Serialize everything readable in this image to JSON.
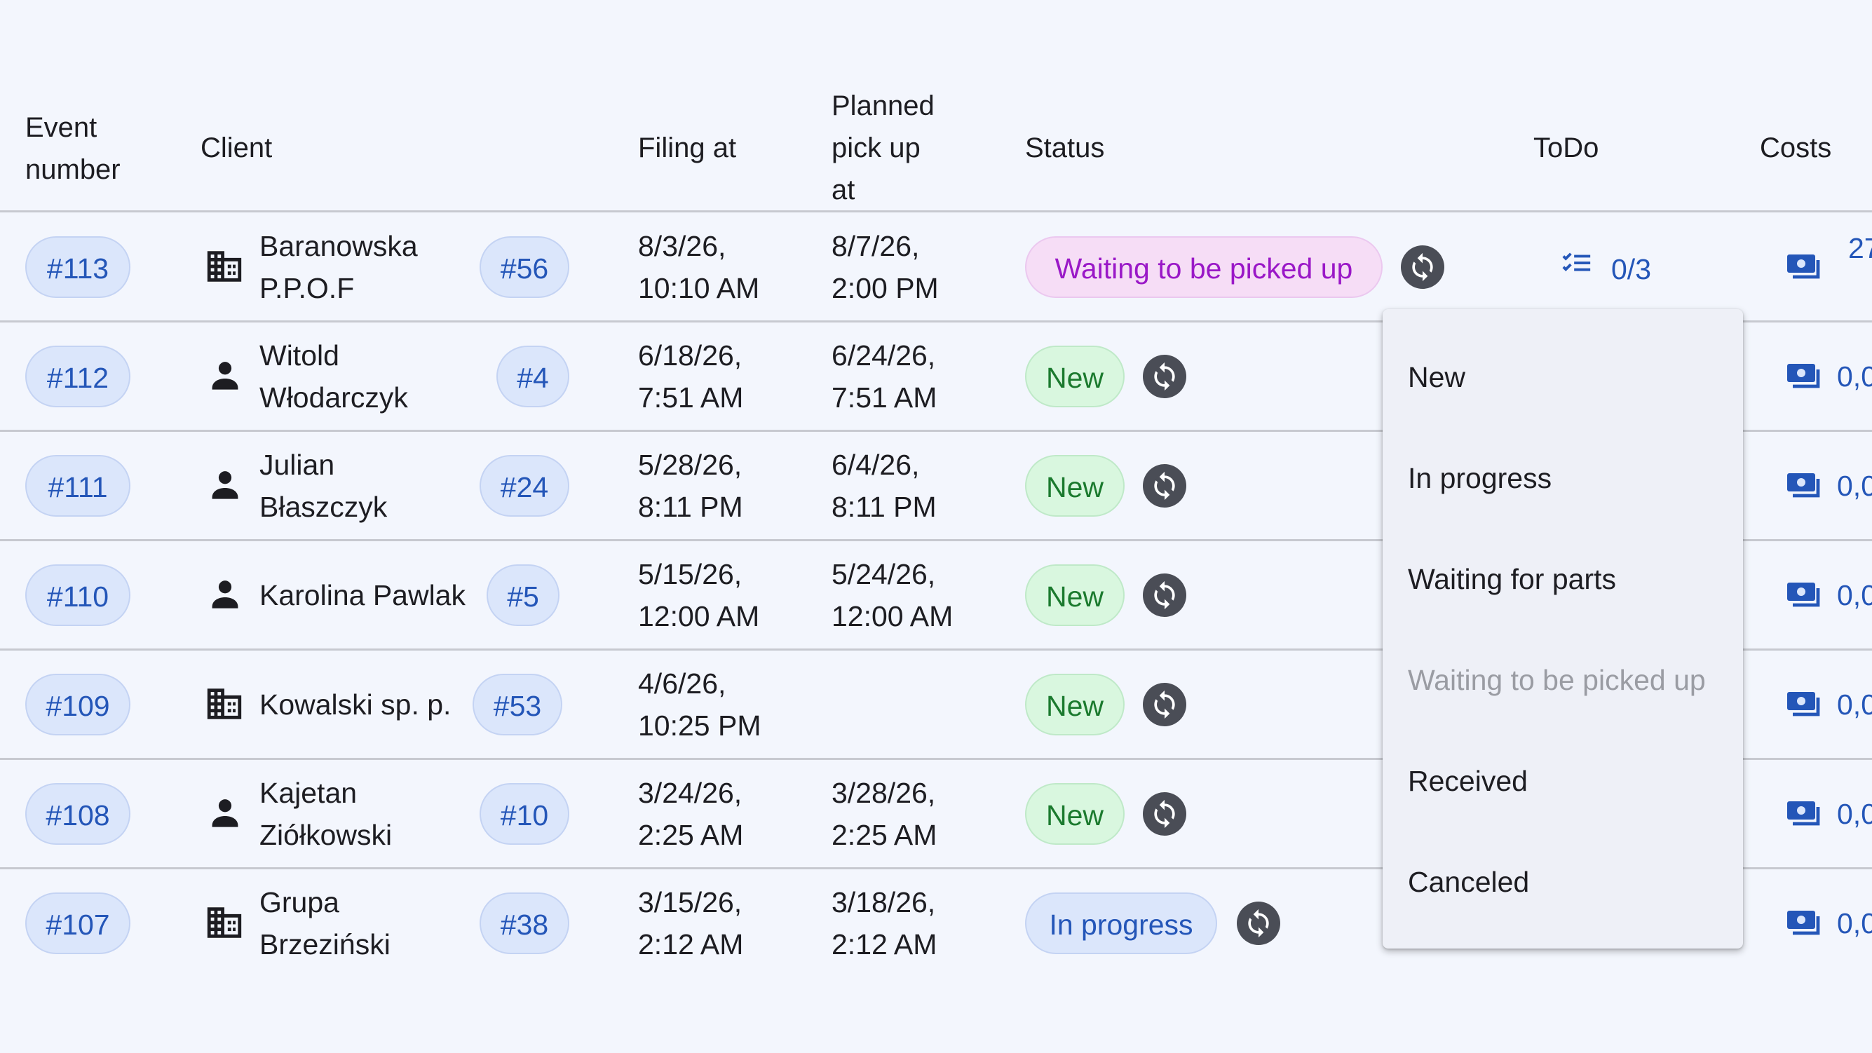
{
  "columns": {
    "event_number": [
      "Event",
      "number"
    ],
    "client": "Client",
    "filing_at": "Filing at",
    "planned_pick_up": [
      "Planned",
      "pick up",
      "at"
    ],
    "status": "Status",
    "todo": "ToDo",
    "costs": "Costs"
  },
  "rows": [
    {
      "event": "#113",
      "client_type": "building-icon",
      "client_lines": [
        "Baranowska",
        "P.P.O.F"
      ],
      "client_id": "#56",
      "filing": [
        "8/3/26,",
        "10:10 AM"
      ],
      "pickup": [
        "8/7/26,",
        "2:00 PM"
      ],
      "status": "Waiting to be picked up",
      "todo": "0/3",
      "cost": "27"
    },
    {
      "event": "#112",
      "client_type": "person-icon",
      "client_lines": [
        "Witold",
        "Włodarczyk"
      ],
      "client_id": "#4",
      "filing": [
        "6/18/26,",
        "7:51 AM"
      ],
      "pickup": [
        "6/24/26,",
        "7:51 AM"
      ],
      "status": "New",
      "cost": "0,0"
    },
    {
      "event": "#111",
      "client_type": "person-icon",
      "client_lines": [
        "Julian",
        "Błaszczyk"
      ],
      "client_id": "#24",
      "filing": [
        "5/28/26,",
        "8:11 PM"
      ],
      "pickup": [
        "6/4/26,",
        "8:11 PM"
      ],
      "status": "New",
      "cost": "0,0"
    },
    {
      "event": "#110",
      "client_type": "person-icon",
      "client_lines": [
        "Karolina Pawlak"
      ],
      "client_id": "#5",
      "filing": [
        "5/15/26,",
        "12:00 AM"
      ],
      "pickup": [
        "5/24/26,",
        "12:00 AM"
      ],
      "status": "New",
      "cost": "0,0"
    },
    {
      "event": "#109",
      "client_type": "building-icon",
      "client_lines": [
        "Kowalski sp. p."
      ],
      "client_id": "#53",
      "filing": [
        "4/6/26,",
        "10:25 PM"
      ],
      "pickup": [],
      "status": "New",
      "cost": "0,0"
    },
    {
      "event": "#108",
      "client_type": "person-icon",
      "client_lines": [
        "Kajetan",
        "Ziółkowski"
      ],
      "client_id": "#10",
      "filing": [
        "3/24/26,",
        "2:25 AM"
      ],
      "pickup": [
        "3/28/26,",
        "2:25 AM"
      ],
      "status": "New",
      "cost": "0,0"
    },
    {
      "event": "#107",
      "client_type": "building-icon",
      "client_lines": [
        "Grupa",
        "Brzeziński"
      ],
      "client_id": "#38",
      "filing": [
        "3/15/26,",
        "2:12 AM"
      ],
      "pickup": [
        "3/18/26,",
        "2:12 AM"
      ],
      "status": "In progress",
      "cost": "0,0"
    }
  ],
  "status_menu": {
    "items": [
      "New",
      "In progress",
      "Waiting for parts",
      "Waiting to be picked up",
      "Received",
      "Canceled"
    ],
    "disabled": "Waiting to be picked up"
  },
  "colors": {
    "background": "#f3f6fd",
    "link_blue": "#2456b8",
    "status_new": "#1b7a2e",
    "status_waiting": "#9a18c7",
    "icon_dark": "#4a4d56"
  }
}
